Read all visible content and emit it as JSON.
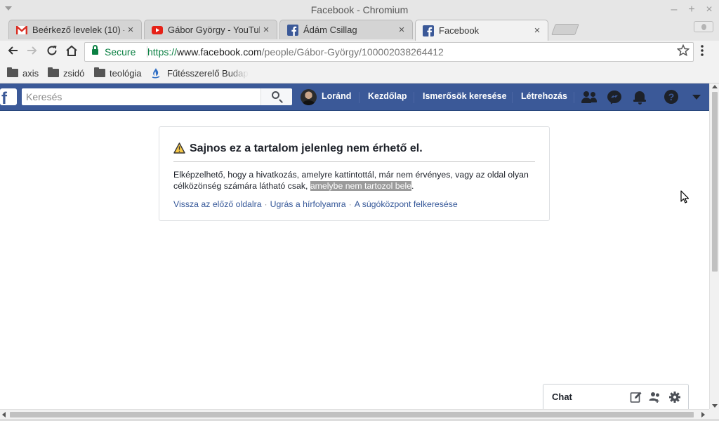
{
  "window": {
    "title": "Facebook - Chromium"
  },
  "tabs": [
    {
      "label": "Beérkező levelek (10) -",
      "favicon": "gmail-icon"
    },
    {
      "label": "Gábor György - YouTub",
      "favicon": "youtube-icon"
    },
    {
      "label": "Ádám Csillag",
      "favicon": "facebook-icon"
    },
    {
      "label": "Facebook",
      "favicon": "facebook-icon",
      "active": true
    }
  ],
  "tab_close": "×",
  "window_controls": {
    "minimize": "–",
    "maximize": "+",
    "close": "×"
  },
  "omnibox": {
    "secure_label": "Secure",
    "scheme": "https://",
    "host": "www.facebook.com",
    "path": "/people/Gábor-György/100002038264412"
  },
  "bookmarks": [
    {
      "label": "axis",
      "icon": "folder-icon"
    },
    {
      "label": "zsidó",
      "icon": "folder-icon"
    },
    {
      "label": "teológia",
      "icon": "folder-icon"
    },
    {
      "label": "Fűtésszerelő Budap",
      "icon": "flame-icon"
    }
  ],
  "fb": {
    "logo": "f",
    "search_placeholder": "Keresés",
    "user_name": "Loránd",
    "nav": [
      "Kezdőlap",
      "Ismerősök keresése",
      "Létrehozás"
    ],
    "help_glyph": "?",
    "brand_color": "#3b5998"
  },
  "error": {
    "title": "Sajnos ez a tartalom jelenleg nem érhető el.",
    "body_line1": "Elképzelhető, hogy a hivatkozás, amelyre kattintottál, már nem érvényes, vagy az oldal olyan",
    "body_line2_prefix": "célközönség számára látható csak,",
    "body_highlight": "amelybe nem tartozol bele",
    "body_suffix": ".",
    "links": [
      "Vissza az előző oldalra",
      "Ugrás a hírfolyamra",
      "A súgóközpont felkeresése"
    ],
    "link_separator": "·"
  },
  "chat": {
    "label": "Chat"
  }
}
